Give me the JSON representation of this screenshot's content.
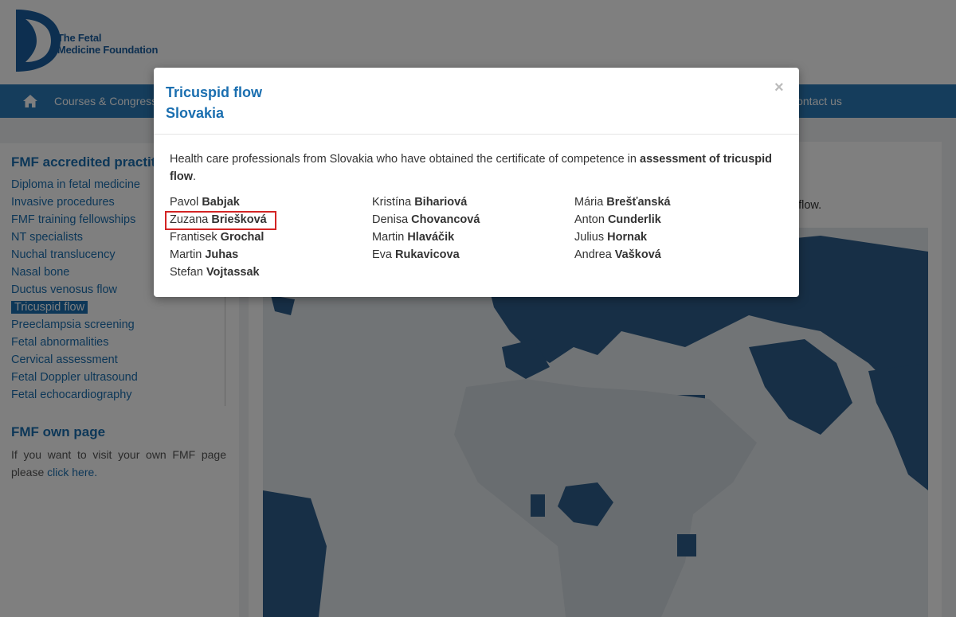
{
  "header": {
    "logo_line1": "The Fetal",
    "logo_line2": "Medicine Foundation"
  },
  "navbar": {
    "items": [
      {
        "label": "Courses & Congresses"
      },
      {
        "label": "Contact us"
      }
    ]
  },
  "sidebar": {
    "section_title": "FMF accredited practitioners",
    "items": [
      {
        "label": "Diploma in fetal medicine"
      },
      {
        "label": "Invasive procedures"
      },
      {
        "label": "FMF training fellowships"
      },
      {
        "label": "NT specialists"
      },
      {
        "label": "Nuchal translucency"
      },
      {
        "label": "Nasal bone"
      },
      {
        "label": "Ductus venosus flow"
      },
      {
        "label": "Tricuspid flow",
        "active": true
      },
      {
        "label": "Preeclampsia screening"
      },
      {
        "label": "Fetal abnormalities"
      },
      {
        "label": "Cervical assessment"
      },
      {
        "label": "Fetal Doppler ultrasound"
      },
      {
        "label": "Fetal echocardiography"
      }
    ],
    "own_page_title": "FMF own page",
    "own_page_text": "If you want to visit your own FMF page please",
    "own_page_link": "click here."
  },
  "content": {
    "tail_text": "d flow."
  },
  "modal": {
    "title_line1": "Tricuspid flow",
    "title_line2": "Slovakia",
    "close_label": "×",
    "intro_text": "Health care professionals from Slovakia who have obtained the certificate of competence in",
    "intro_bold": "assessment of tricuspid flow",
    "intro_end": ".",
    "highlighted_name_index": 1,
    "names": [
      {
        "first": "Pavol",
        "last": "Babjak"
      },
      {
        "first": "Kristína",
        "last": "Bihariová"
      },
      {
        "first": "Mária",
        "last": "Brešťanská"
      },
      {
        "first": "Zuzana",
        "last": "Briešková"
      },
      {
        "first": "Denisa",
        "last": "Chovancová"
      },
      {
        "first": "Anton",
        "last": "Cunderlik"
      },
      {
        "first": "Frantisek",
        "last": "Grochal"
      },
      {
        "first": "Martin",
        "last": "Hlaváčik"
      },
      {
        "first": "Julius",
        "last": "Hornak"
      },
      {
        "first": "Martin",
        "last": "Juhas"
      },
      {
        "first": "Eva",
        "last": "Rukavicova"
      },
      {
        "first": "Andrea",
        "last": "Vašková"
      },
      {
        "first": "Stefan",
        "last": "Vojtassak"
      }
    ]
  },
  "colors": {
    "brand_blue": "#1b6fb0",
    "nav_blue": "#2a7ab8",
    "highlight_red": "#d32424"
  }
}
